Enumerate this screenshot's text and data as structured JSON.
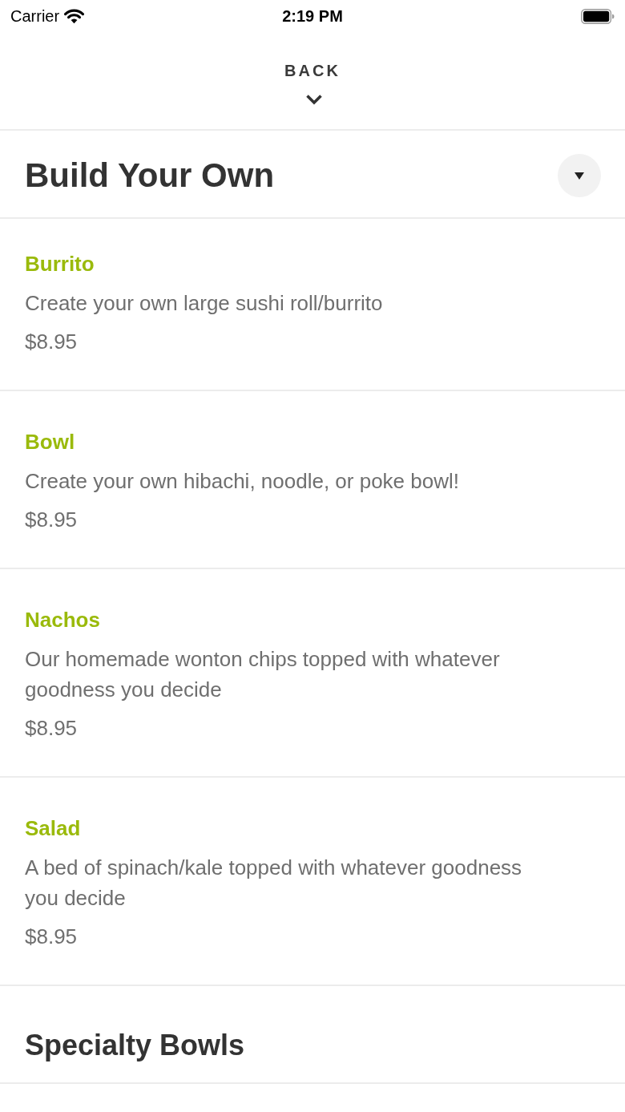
{
  "status_bar": {
    "carrier": "Carrier",
    "time": "2:19 PM"
  },
  "nav": {
    "back_label": "BACK"
  },
  "sections": [
    {
      "kind": "open",
      "title": "Build Your Own",
      "items": [
        {
          "name": "Burrito",
          "description": "Create your own large sushi roll/burrito",
          "price": "$8.95"
        },
        {
          "name": "Bowl",
          "description": "Create your own hibachi, noodle, or poke bowl!",
          "price": "$8.95"
        },
        {
          "name": "Nachos",
          "description": "Our homemade wonton chips topped with whatever goodness you decide",
          "price": "$8.95"
        },
        {
          "name": "Salad",
          "description": "A bed of spinach/kale topped with whatever goodness you decide",
          "price": "$8.95"
        }
      ]
    },
    {
      "kind": "closed",
      "title": "Specialty Bowls"
    }
  ]
}
